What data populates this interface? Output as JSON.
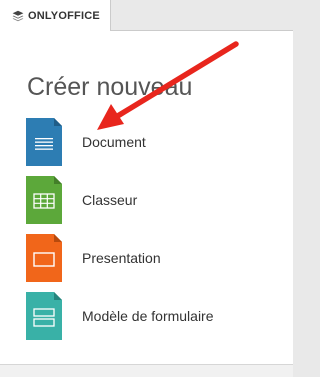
{
  "tab": {
    "brand": "ONLYOFFICE",
    "icon": "onlyoffice-logo-icon"
  },
  "panel": {
    "title": "Créer nouveau",
    "items": [
      {
        "label": "Document",
        "icon": "document-file-icon",
        "color": "#2d7db3"
      },
      {
        "label": "Classeur",
        "icon": "spreadsheet-file-icon",
        "color": "#5ca83a"
      },
      {
        "label": "Presentation",
        "icon": "presentation-file-icon",
        "color": "#f1661a"
      },
      {
        "label": "Modèle de formulaire",
        "icon": "form-template-file-icon",
        "color": "#39b1a7"
      }
    ]
  },
  "annotation": {
    "arrow_color": "#e8261d"
  }
}
